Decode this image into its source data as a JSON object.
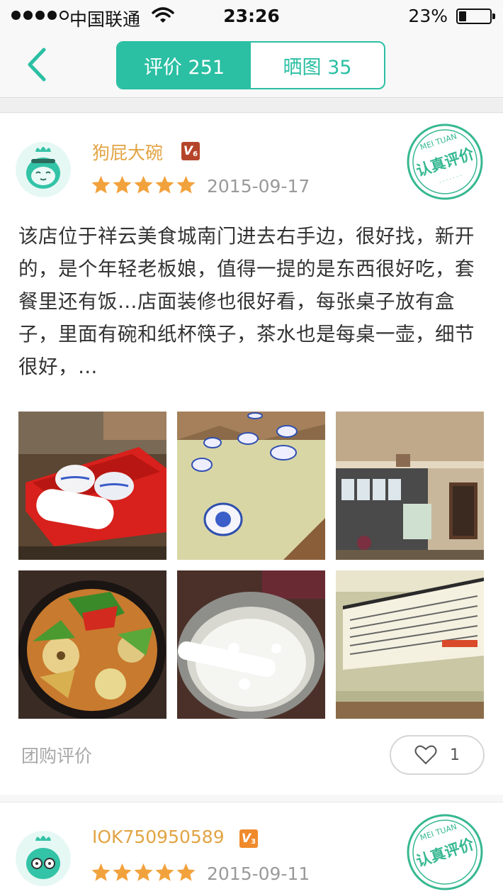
{
  "status_bar": {
    "carrier": "中国联通",
    "time": "23:26",
    "battery": "23%",
    "battery_level": 0.23
  },
  "nav": {
    "back_icon": "chevron-left-icon",
    "tabs": [
      {
        "label": "评价 251",
        "active": true
      },
      {
        "label": "晒图 35",
        "active": false
      }
    ]
  },
  "colors": {
    "accent": "#2bbfa3",
    "star": "#f2a23c",
    "username": "#e2a444"
  },
  "reviews": [
    {
      "username": "狗屁大碗",
      "vip_level": "V",
      "vip_num": "6",
      "rating": 5,
      "date": "2015-09-17",
      "stamp": {
        "top": "MEI TUAN",
        "main": "认真评价"
      },
      "text": "该店位于祥云美食城南门进去右手边，很好找，新开的，是个年轻老板娘，值得一提的是东西很好吃，套餐里还有饭…店面装修也很好看，每张桌子放有盒子，里面有碗和纸杯筷子，茶水也是每桌一壶，细节很好，…",
      "photos": [
        "red-box-with-bowls",
        "table-with-dishes",
        "restaurant-interior",
        "stir-fry-dish",
        "bowl-of-rice",
        "menu-wall"
      ],
      "group_label": "团购评价",
      "likes": "1"
    },
    {
      "username": "IOK750950589",
      "vip_level": "V",
      "vip_num": "3",
      "rating": 5,
      "date": "2015-09-11",
      "stamp": {
        "top": "MEI TUAN",
        "main": "认真评价"
      }
    }
  ]
}
